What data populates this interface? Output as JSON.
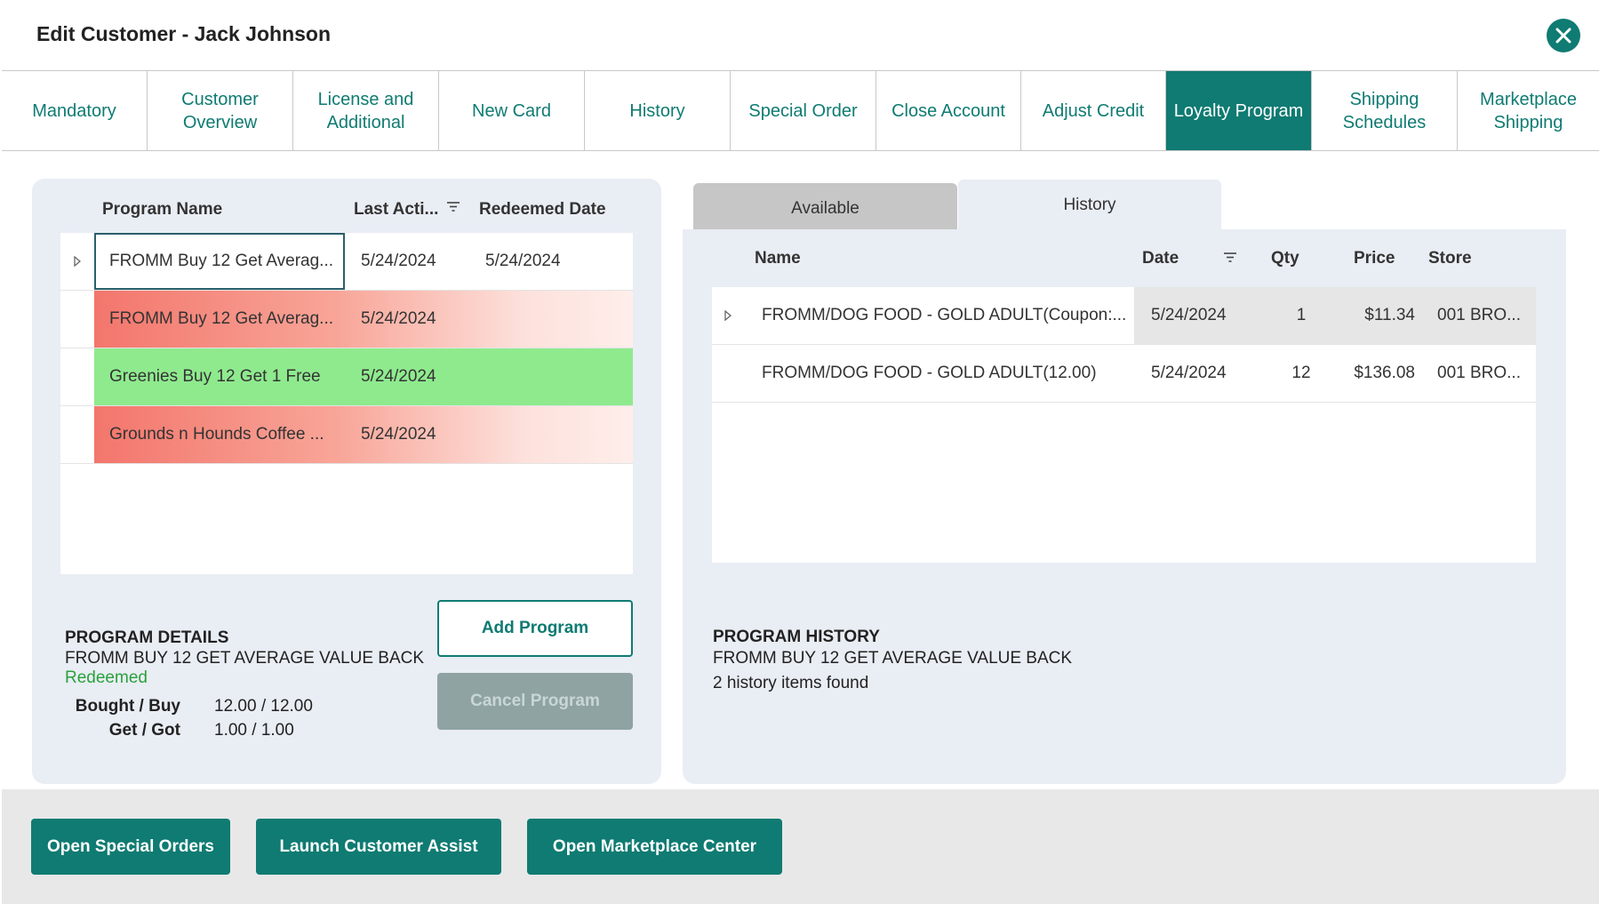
{
  "window": {
    "title": "Edit Customer - Jack Johnson"
  },
  "tabs": [
    {
      "label": "Mandatory",
      "active": false
    },
    {
      "label": "Customer Overview",
      "active": false
    },
    {
      "label": "License and Additional",
      "active": false
    },
    {
      "label": "New Card",
      "active": false
    },
    {
      "label": "History",
      "active": false
    },
    {
      "label": "Special Order",
      "active": false
    },
    {
      "label": "Close Account",
      "active": false
    },
    {
      "label": "Adjust Credit",
      "active": false
    },
    {
      "label": "Loyalty Program",
      "active": true
    },
    {
      "label": "Shipping Schedules",
      "active": false
    },
    {
      "label": "Marketplace Shipping",
      "active": false
    }
  ],
  "programs": {
    "columns": {
      "name": "Program Name",
      "last_activity": "Last Acti...",
      "redeemed_date": "Redeemed Date"
    },
    "rows": [
      {
        "name": "FROMM Buy 12 Get Averag...",
        "last_activity": "5/24/2024",
        "redeemed_date": "5/24/2024",
        "style": "selected"
      },
      {
        "name": "FROMM Buy 12 Get Averag...",
        "last_activity": "5/24/2024",
        "redeemed_date": "",
        "style": "red"
      },
      {
        "name": "Greenies Buy 12 Get 1 Free",
        "last_activity": "5/24/2024",
        "redeemed_date": "",
        "style": "green"
      },
      {
        "name": "Grounds n Hounds Coffee ...",
        "last_activity": "5/24/2024",
        "redeemed_date": "",
        "style": "red"
      }
    ]
  },
  "program_details": {
    "header": "PROGRAM DETAILS",
    "name": "FROMM BUY 12 GET AVERAGE VALUE BACK",
    "status": "Redeemed",
    "bought_label": "Bought / Buy",
    "bought_value": "12.00 / 12.00",
    "get_label": "Get / Got",
    "get_value": "1.00 / 1.00"
  },
  "buttons": {
    "add_program": "Add Program",
    "cancel_program": "Cancel Program"
  },
  "right_tabs": {
    "available": "Available",
    "history": "History"
  },
  "history": {
    "columns": {
      "name": "Name",
      "date": "Date",
      "qty": "Qty",
      "price": "Price",
      "store": "Store"
    },
    "rows": [
      {
        "name": "FROMM/DOG FOOD - GOLD ADULT(Coupon:...",
        "date": "5/24/2024",
        "qty": "1",
        "price": "$11.34",
        "store": "001 BRO..."
      },
      {
        "name": "FROMM/DOG FOOD - GOLD ADULT(12.00)",
        "date": "5/24/2024",
        "qty": "12",
        "price": "$136.08",
        "store": "001 BRO..."
      }
    ]
  },
  "program_history": {
    "header": "PROGRAM HISTORY",
    "name": "FROMM BUY 12 GET AVERAGE VALUE BACK",
    "count_text": "2 history items found"
  },
  "footer": {
    "open_special_orders": "Open Special Orders",
    "launch_customer_assist": "Launch Customer Assist",
    "open_marketplace_center": "Open Marketplace Center"
  },
  "colors": {
    "accent": "#0f7b72",
    "redeemed_status": "#2aa13c",
    "row_green": "#8fea8e",
    "row_red": "#f3766c"
  }
}
